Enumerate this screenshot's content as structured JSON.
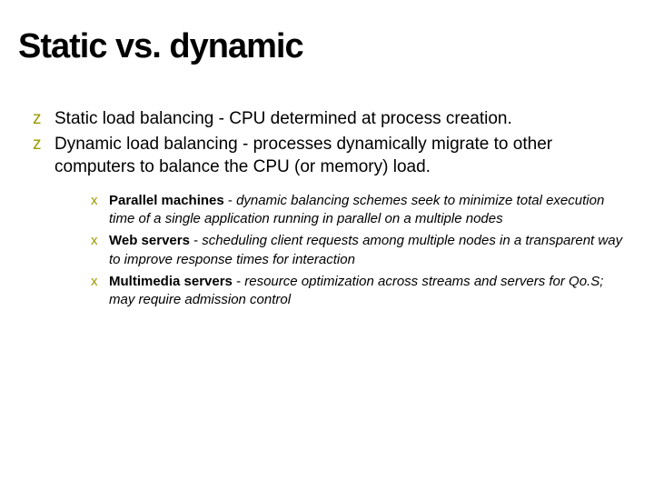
{
  "slide": {
    "title": "Static vs. dynamic",
    "bullets": [
      {
        "text": "Static load balancing - CPU determined at process creation."
      },
      {
        "text": "Dynamic load balancing - processes dynamically migrate to other computers to balance the CPU (or memory) load."
      }
    ],
    "sub_bullets": [
      {
        "bold": "Parallel machines",
        "dash": " - ",
        "rest": "dynamic balancing schemes seek to minimize total execution time of a single application running in parallel on a multiple nodes"
      },
      {
        "bold": "Web servers",
        "dash": " - ",
        "rest": "scheduling client requests among multiple nodes in a transparent way to improve response times for interaction"
      },
      {
        "bold": "Multimedia servers",
        "dash": " - ",
        "rest": "resource optimization across streams and servers for Qo.S; may require admission control"
      }
    ]
  }
}
